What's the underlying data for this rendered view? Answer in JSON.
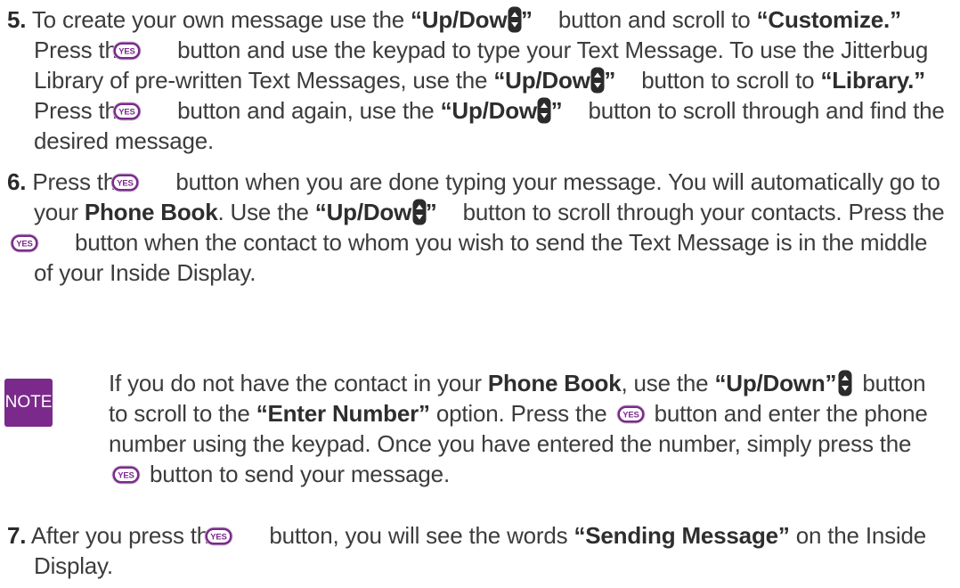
{
  "steps": [
    {
      "number": "5.",
      "runs": [
        {
          "t": "To create your own message use the  "
        },
        {
          "t": "“Up/Down”",
          "b": true
        },
        {
          "icon": "updown"
        },
        {
          "t": " button and scroll to "
        },
        {
          "t": "“Customize.”",
          "b": true
        },
        {
          "t": " Press the "
        },
        {
          "icon": "yes"
        },
        {
          "t": " button and use the keypad to type your Text Message. To use the Jitterbug Library of pre-written Text Messages, use the "
        },
        {
          "t": "“Up/Down”",
          "b": true
        },
        {
          "icon": "updown"
        },
        {
          "t": " button to scroll to "
        },
        {
          "t": "“Library.”",
          "b": true
        },
        {
          "t": " Press the "
        },
        {
          "icon": "yes"
        },
        {
          "t": " button and again, use the "
        },
        {
          "t": "“Up/Down”",
          "b": true
        },
        {
          "icon": "updown"
        },
        {
          "t": " button to scroll through and find the desired message."
        }
      ]
    },
    {
      "number": "6.",
      "runs": [
        {
          "t": " Press the "
        },
        {
          "icon": "yes"
        },
        {
          "t": " button when you are done typing your message. You will automatically go to your "
        },
        {
          "t": "Phone Book",
          "b": true
        },
        {
          "t": ".  Use the "
        },
        {
          "t": "“Up/Down”",
          "b": true
        },
        {
          "icon": "updown"
        },
        {
          "t": " button to scroll through your contacts. Press the "
        },
        {
          "icon": "yes"
        },
        {
          "t": " button when the contact to whom you wish to send the Text Message is in the middle of your Inside Display."
        }
      ]
    },
    {
      "number": "7.",
      "runs": [
        {
          "t": " After you press the "
        },
        {
          "icon": "yes"
        },
        {
          "t": " button, you will see the words "
        },
        {
          "t": "“Sending Message”",
          "b": true
        },
        {
          "t": " on the Inside Display."
        }
      ]
    }
  ],
  "note": {
    "badge": "NOTE",
    "runs": [
      {
        "t": "If you do not have the contact in your "
      },
      {
        "t": "Phone Book",
        "b": true
      },
      {
        "t": ", use the "
      },
      {
        "t": "“Up/Down”",
        "b": true
      },
      {
        "icon": "updown"
      },
      {
        "t": " button to scroll to the "
      },
      {
        "t": "“Enter Number”",
        "b": true
      },
      {
        "t": " option. Press the "
      },
      {
        "icon": "yes"
      },
      {
        "t": " button and enter the phone number using the keypad.  Once you have entered the number, simply press the "
      },
      {
        "icon": "yes"
      },
      {
        "t": " button to send your message."
      }
    ]
  },
  "icons": {
    "yes_label": "YES",
    "yes_color": "#7b2a8b",
    "updown_color": "#2b2b2b"
  }
}
